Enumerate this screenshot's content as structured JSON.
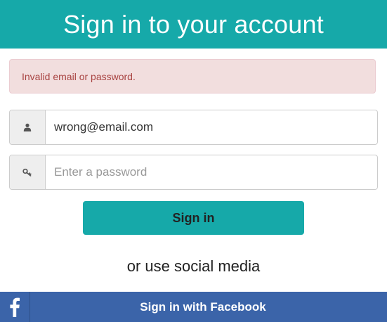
{
  "header": {
    "title": "Sign in to your account"
  },
  "alert": {
    "message": "Invalid email or password."
  },
  "form": {
    "email": {
      "icon": "user-icon",
      "value": "wrong@email.com",
      "placeholder": ""
    },
    "password": {
      "icon": "key-icon",
      "value": "",
      "placeholder": "Enter a password"
    },
    "submit_label": "Sign in"
  },
  "social": {
    "divider_text": "or use social media",
    "facebook": {
      "icon": "facebook-icon",
      "label": "Sign in with Facebook"
    }
  },
  "colors": {
    "primary": "#16a9a9",
    "alert_bg": "#f2dede",
    "alert_text": "#a94442",
    "facebook": "#3b64a9"
  }
}
